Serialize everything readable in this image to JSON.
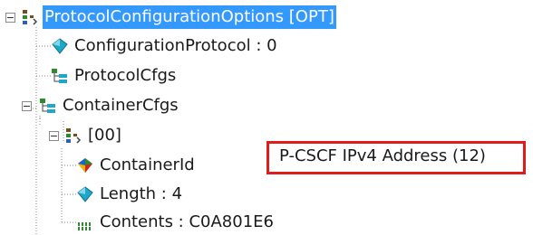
{
  "tree": {
    "root": {
      "label": "ProtocolConfigurationOptions [OPT]",
      "icon": "struct-icon",
      "expanded": true,
      "selected": true
    },
    "items": [
      {
        "label": "ConfigurationProtocol : 0",
        "icon": "cyan-gem-icon"
      },
      {
        "label": "ProtocolCfgs",
        "icon": "list-icon"
      },
      {
        "label": "ContainerCfgs",
        "icon": "list-icon",
        "expanded": true
      }
    ],
    "container": {
      "label": "[00]",
      "icon": "struct-icon",
      "expanded": true,
      "children": [
        {
          "label": "ContainerId",
          "icon": "multicolor-gem-icon"
        },
        {
          "label": "Length : 4",
          "icon": "cyan-gem-icon"
        },
        {
          "label": "Contents : C0A801E6",
          "icon": "binary-icon"
        }
      ]
    }
  },
  "annotation": {
    "text": "P-CSCF IPv4 Address (12)",
    "color": "#e11b1b"
  }
}
